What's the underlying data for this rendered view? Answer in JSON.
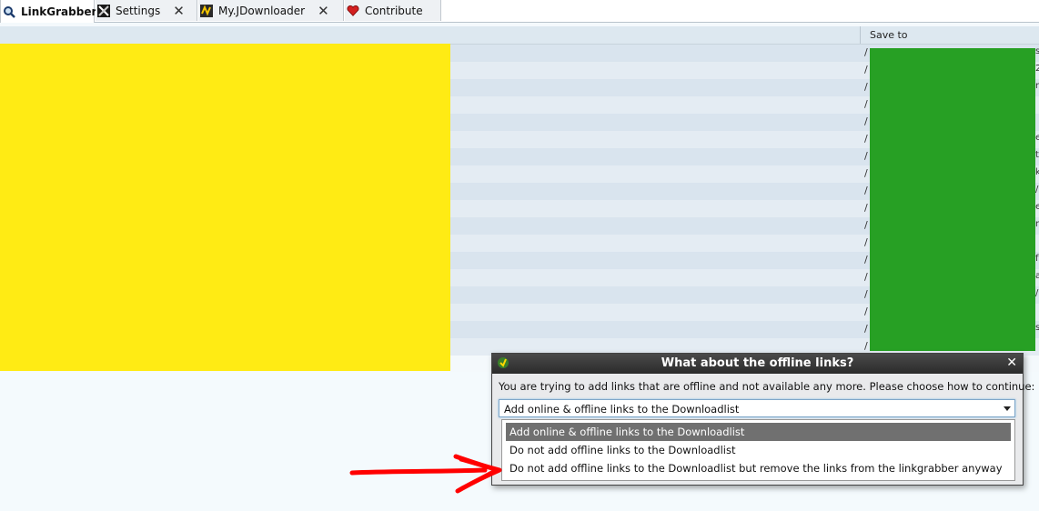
{
  "tabs": [
    {
      "label": "LinkGrabber",
      "active": true,
      "icon": "magnifier-icon"
    },
    {
      "label": "Settings",
      "icon": "tools-icon"
    },
    {
      "label": "My.JDownloader",
      "icon": "jdownloader-icon"
    },
    {
      "label": "Contribute",
      "icon": "heart-icon"
    }
  ],
  "table": {
    "columns": [
      "Save to"
    ],
    "rows": [
      {
        "save_to": "/",
        "tail": "s"
      },
      {
        "save_to": "/",
        "tail": "2"
      },
      {
        "save_to": "/",
        "tail": "r"
      },
      {
        "save_to": "/",
        "tail": ""
      },
      {
        "save_to": "/",
        "tail": ""
      },
      {
        "save_to": "/",
        "tail": "e"
      },
      {
        "save_to": "/",
        "tail": "t"
      },
      {
        "save_to": "/",
        "tail": "k"
      },
      {
        "save_to": "/",
        "tail": "/"
      },
      {
        "save_to": "/",
        "tail": "e"
      },
      {
        "save_to": "/",
        "tail": "n"
      },
      {
        "save_to": "/",
        "tail": ""
      },
      {
        "save_to": "/",
        "tail": "f"
      },
      {
        "save_to": "/",
        "tail": "a"
      },
      {
        "save_to": "/",
        "tail": "/"
      },
      {
        "save_to": "/",
        "tail": ""
      },
      {
        "save_to": "/",
        "tail": "s"
      },
      {
        "save_to": "/",
        "tail": ""
      }
    ]
  },
  "dialog": {
    "title": "What about the offline links?",
    "message": "You are trying to add links that are offline and not available any more. Please choose how to continue:",
    "selected": "Add online & offline links to the Downloadlist",
    "options": [
      "Add online & offline links to the Downloadlist",
      "Do not add offline links to the Downloadlist",
      "Do not add offline links to the Downloadlist but remove the links from the linkgrabber anyway"
    ],
    "close_icon": "close-icon"
  },
  "colors": {
    "redaction_yellow": "#ffeb14",
    "redaction_green": "#27a024",
    "annotation_arrow": "#ff0000"
  }
}
